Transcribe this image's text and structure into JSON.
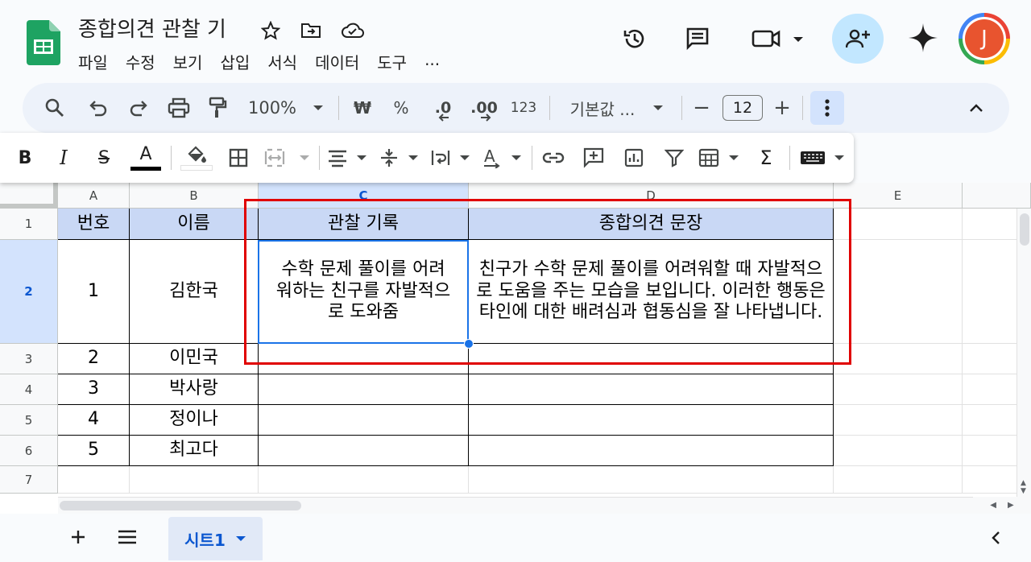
{
  "doc": {
    "title": "종합의견 관찰 기"
  },
  "menu": [
    "파일",
    "수정",
    "보기",
    "삽입",
    "서식",
    "데이터",
    "도구",
    "..."
  ],
  "account": {
    "avatar_letter": "J"
  },
  "toolbar": {
    "zoom": "100%",
    "currency": "₩",
    "percent": "%",
    "dec_decrease": ".0",
    "dec_increase": ".00",
    "number_format": "123",
    "font": "기본값 ...",
    "font_size": "12",
    "minus": "−",
    "plus": "+",
    "bold": "B",
    "italic": "I",
    "strike": "S",
    "text_color": "A",
    "sum": "Σ"
  },
  "grid": {
    "columns": [
      "A",
      "B",
      "C",
      "D",
      "E"
    ],
    "rows": [
      "1",
      "2",
      "3",
      "4",
      "5",
      "6",
      "7"
    ],
    "headers": {
      "num": "번호",
      "name": "이름",
      "record": "관찰 기록",
      "opinion": "종합의견 문장"
    },
    "students": [
      {
        "num": "1",
        "name": "김한국"
      },
      {
        "num": "2",
        "name": "이민국"
      },
      {
        "num": "3",
        "name": "박사랑"
      },
      {
        "num": "4",
        "name": "정이나"
      },
      {
        "num": "5",
        "name": "최고다"
      }
    ],
    "record_1": "수학 문제 풀이를 어려워하는 친구를 자발적으로 도와줌",
    "opinion_1": "친구가 수학 문제 풀이를 어려워할 때 자발적으로 도움을 주는 모습을 보입니다. 이러한 행동은 타인에 대한 배려심과 협동심을 잘 나타냅니다."
  },
  "sheets": {
    "active": "시트1"
  },
  "colors": {
    "accent": "#0b57d0",
    "highlight_box": "#e00000",
    "header_fill": "#c9d8f5",
    "avatar": "#e8542f"
  }
}
